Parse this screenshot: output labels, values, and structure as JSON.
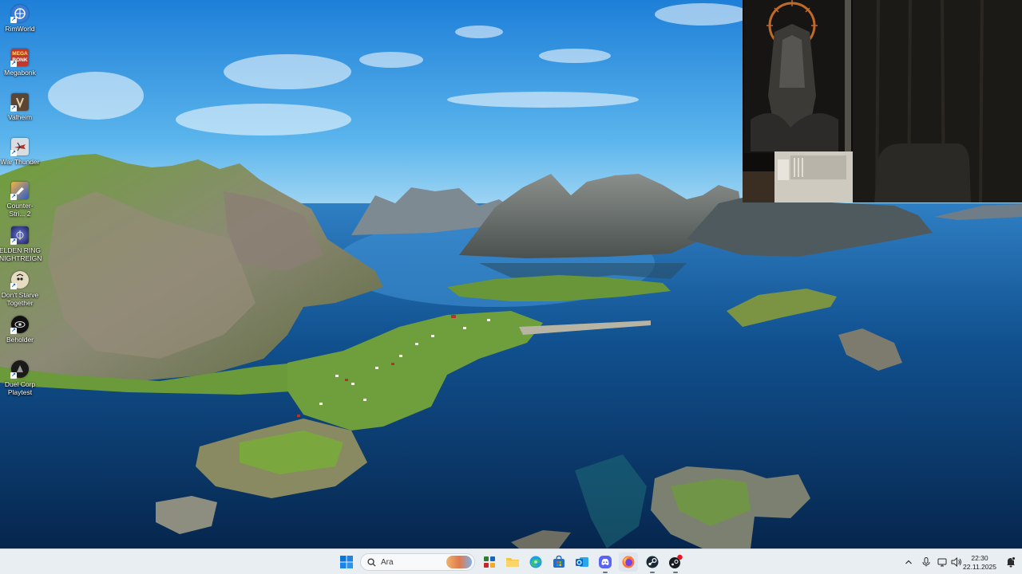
{
  "desktop_icons": [
    {
      "label": "RimWorld",
      "icon": "rimworld-icon",
      "color": "#3a7bd5"
    },
    {
      "label": "Megabonk",
      "icon": "megabonk-icon",
      "color": "#c0392b",
      "badge": "MEGA\nBONK"
    },
    {
      "label": "Valheim",
      "icon": "valheim-icon",
      "color": "#5b4636"
    },
    {
      "label": "War Thunder",
      "icon": "war-thunder-icon",
      "color": "#9aa3ad"
    },
    {
      "label": "Counter-Stri... 2",
      "icon": "counter-strike-icon",
      "color": "#e8a33c"
    },
    {
      "label": "ELDEN RING NIGHTREIGN",
      "icon": "elden-ring-nightreign-icon",
      "color": "#2b2f6b"
    },
    {
      "label": "Don't Starve Together",
      "icon": "dont-starve-together-icon",
      "color": "#d9c9a3"
    },
    {
      "label": "Beholder",
      "icon": "beholder-icon",
      "color": "#111111"
    },
    {
      "label": "Duel Corp Playtest",
      "icon": "duel-corp-icon",
      "color": "#1a1a1a"
    }
  ],
  "taskbar": {
    "search_placeholder": "Ara",
    "pinned_apps": [
      {
        "name": "start-button",
        "icon": "windows-logo-icon"
      },
      {
        "name": "widgets",
        "icon": "widgets-icon"
      },
      {
        "name": "file-explorer",
        "icon": "folder-icon"
      },
      {
        "name": "edge",
        "icon": "edge-icon"
      },
      {
        "name": "microsoft-store",
        "icon": "store-icon"
      },
      {
        "name": "outlook",
        "icon": "outlook-icon"
      },
      {
        "name": "discord",
        "icon": "discord-icon"
      },
      {
        "name": "firefox",
        "icon": "firefox-icon"
      },
      {
        "name": "steam",
        "icon": "steam-icon"
      },
      {
        "name": "steam-notify",
        "icon": "steam-badge-icon"
      }
    ],
    "tray": {
      "clock_time": "22:30",
      "clock_date": "22.11.2025"
    }
  },
  "colors": {
    "taskbar_bg": "#e9eef3",
    "accent": "#0067c0"
  }
}
